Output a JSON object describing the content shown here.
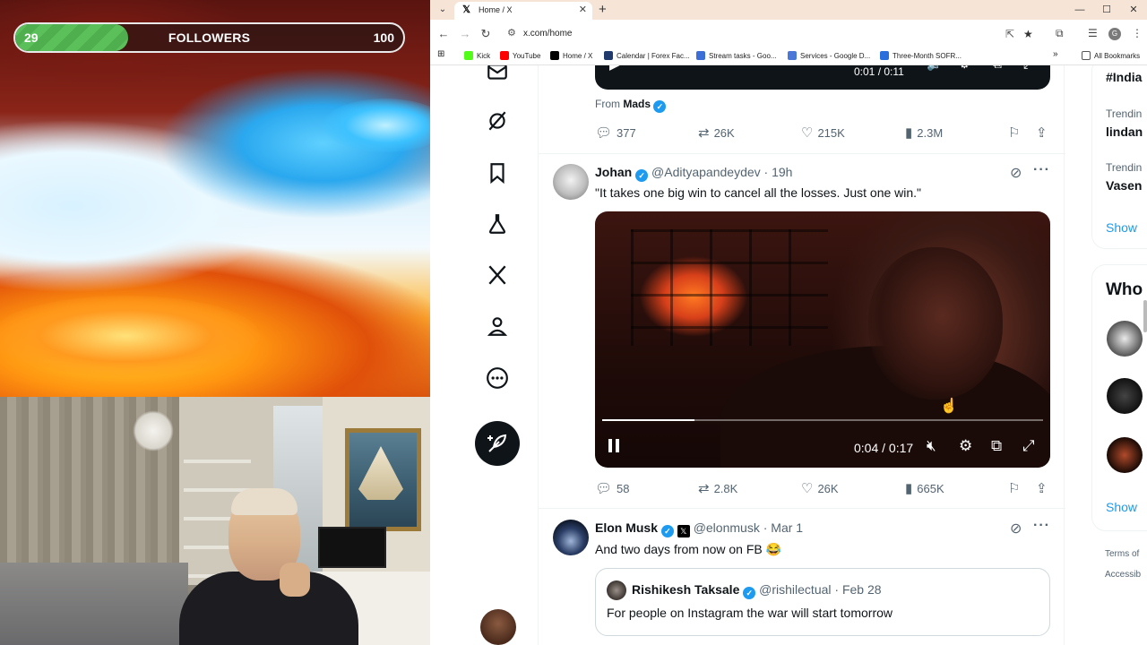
{
  "overlay": {
    "followers": {
      "current": "29",
      "label": "FOLLOWERS",
      "goal": "100",
      "progress_fraction": 0.29
    }
  },
  "browser": {
    "tab": {
      "title": "Home / X",
      "icon": "x-logo-icon"
    },
    "url": "x.com/home",
    "bookmarks": [
      {
        "label": "Kick",
        "color": "#53fc18"
      },
      {
        "label": "YouTube",
        "color": "#ff0000"
      },
      {
        "label": "Home / X",
        "color": "#000000"
      },
      {
        "label": "Calendar | Forex Fac...",
        "color": "#1f3a6b"
      },
      {
        "label": "Stream tasks - Goo...",
        "color": "#3b6ed6"
      },
      {
        "label": "Services - Google D...",
        "color": "#4a78d8"
      },
      {
        "label": "Three-Month SOFR...",
        "color": "#2a6fdb"
      }
    ],
    "all_bookmarks_label": "All Bookmarks"
  },
  "x": {
    "accent": "#1d9bf0",
    "top_post": {
      "video_time": "0:01 / 0:11",
      "from_prefix": "From",
      "from_name": "Mads",
      "replies": "377",
      "reposts": "26K",
      "likes": "215K",
      "views": "2.3M"
    },
    "post1": {
      "name": "Johan",
      "handle": "@Adityapandeydev",
      "time": "19h",
      "text": "\"It takes one big win to cancel all the losses. Just one win.\"",
      "video_time": "0:04 / 0:17",
      "video_progress_fraction": 0.21,
      "replies": "58",
      "reposts": "2.8K",
      "likes": "26K",
      "views": "665K"
    },
    "post2": {
      "name": "Elon Musk",
      "handle": "@elonmusk",
      "time": "Mar 1",
      "text": "And two days from now on FB 😂",
      "quote": {
        "name": "Rishikesh Taksale",
        "handle": "@rishilectual",
        "time": "Feb 28",
        "text": "For people on Instagram the war will start tomorrow"
      }
    },
    "right": {
      "trend1": "#India",
      "trend2_label": "Trendin",
      "trend2": "lindan",
      "trend3_label": "Trendin",
      "trend3": "Vasen",
      "show_more": "Show",
      "who_title": "Who",
      "show_more2": "Show",
      "terms": "Terms of",
      "access": "Accessib"
    }
  }
}
